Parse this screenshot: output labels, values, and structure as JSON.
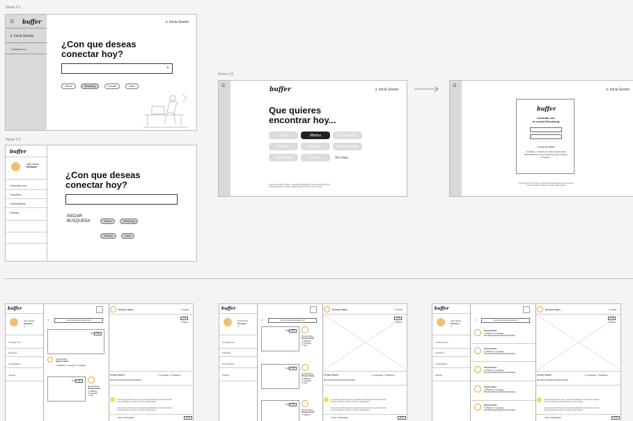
{
  "labels": {
    "v1": "Home V.1",
    "v2": "Home V.2",
    "v3": "Home V.3"
  },
  "brand": "buffer",
  "login": "Inicia Sesión",
  "v1": {
    "sidebar_login": "Inicia Sesión",
    "sidebar_connect": "Conectar con...",
    "hero_line1": "¿Con que deseas",
    "hero_line2": "conectar hoy?",
    "chips": [
      "Videos",
      "Streaming",
      "Podcast",
      "Clase"
    ]
  },
  "v2": {
    "user_name": "User Name",
    "user_role": "Streamer",
    "sidebar": [
      "Conectar con...",
      "Favoritos",
      "Compartidos",
      "Fellows"
    ],
    "hero_line1": "¿Con que deseas",
    "hero_line2": "conectar hoy?",
    "cta_line1": "INICIAR",
    "cta_line2": "BUSQUEDA",
    "chips": [
      "Videos",
      "Streaming",
      "Podcast",
      "Clase"
    ]
  },
  "v3": {
    "hero_line1": "Que quieres",
    "hero_line2": "encontrar hoy...",
    "tiles": [
      "Arte",
      "Música",
      "Gastronomía",
      "Deporte",
      "Negocio",
      "Estilo de vida",
      "Tecnología",
      "Ciencia"
    ],
    "more": "Ver mas...",
    "footer": "Lorem ipsum dolor sit amet, consectetur adipiscing elit, sed do eiusmod tempor incididunt ut labore et dolore magna aliqua. Ut enim ad minim veniam."
  },
  "connect": {
    "title_line1": "Conectar con",
    "title_line2": "tu cuenta Streaming",
    "or_create": "o crea un cuenta",
    "desc": "comparte y conecta con miles de personas interesadas en lo que tienes que dar y mostrar al mundo...",
    "footer": "Lorem ipsum dolor sit amet, consectetur adipiscing elit, sed do eiusmod tempor incididunt ut labore et dolore magna aliqua."
  },
  "stream": {
    "user_name": "User Name",
    "user_role": "Streamer",
    "user_num": "3",
    "sidebar": [
      "Conectar con...",
      "Favoritos",
      "Compartidos",
      "Fellows"
    ],
    "search_placeholder": "¿Con que deseas conectar hoy?",
    "streamer_name": "Streamer Name",
    "follow": "Follow",
    "live": "LIVE",
    "share": "Share",
    "card_name": "StreamerName",
    "checks": [
      "Plataform",
      "Language",
      "Type"
    ],
    "video_name": "#Video Name",
    "language": "Language",
    "plataform": "Plataform",
    "hashtags": "#Hashtag  #Hashtag  #Hashtag  #Hashtag",
    "chat_text": "Lorem ipsum dolor sit amet, consectetur adipiscing elit, sed do eiusmod tempor incididunt ut labore et dolore magna aliqua.",
    "message_placeholder": "Send a Messages",
    "send": "Send",
    "views": "1234"
  }
}
